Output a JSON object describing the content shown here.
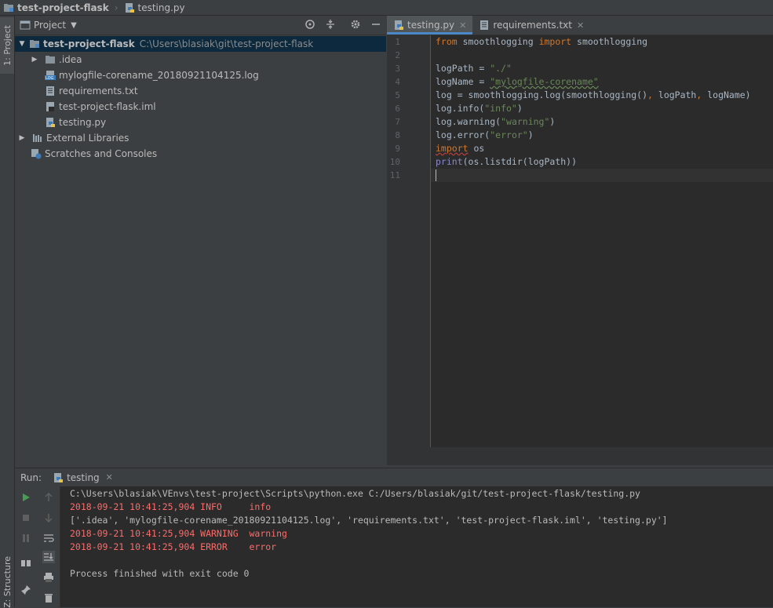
{
  "navbar": {
    "project": "test-project-flask",
    "file": "testing.py"
  },
  "left_stripe": {
    "project_tab": "1: Project",
    "structure_tab": "Z: Structure"
  },
  "project_panel": {
    "title": "Project",
    "root": {
      "label": "test-project-flask",
      "path": "C:\\Users\\blasiak\\git\\test-project-flask"
    },
    "items": [
      {
        "label": ".idea",
        "icon": "folder-icon"
      },
      {
        "label": "mylogfile-corename_20180921104125.log",
        "icon": "log-file-icon"
      },
      {
        "label": "requirements.txt",
        "icon": "text-file-icon"
      },
      {
        "label": "test-project-flask.iml",
        "icon": "iml-file-icon"
      },
      {
        "label": "testing.py",
        "icon": "python-file-icon"
      }
    ],
    "external_libraries": "External Libraries",
    "scratches": "Scratches and Consoles"
  },
  "editor": {
    "tabs": [
      {
        "label": "testing.py",
        "active": true
      },
      {
        "label": "requirements.txt",
        "active": false
      }
    ],
    "line_numbers": [
      "1",
      "2",
      "3",
      "4",
      "5",
      "6",
      "7",
      "8",
      "9",
      "10",
      "11"
    ],
    "code": {
      "l1_kw_from": "from",
      "l1_mod": " smoothlogging ",
      "l1_kw_import": "import",
      "l1_name": " smoothlogging",
      "l3_a": "logPath = ",
      "l3_str": "\"./\"",
      "l4_a": "logName = ",
      "l4_str": "\"mylogfile-corename\"",
      "l5_a": "log = smoothlogging.log(smoothlogging()",
      "l5_comma1": ",",
      "l5_b": " logPath",
      "l5_comma2": ",",
      "l5_c": " logName)",
      "l6_a": "log.info(",
      "l6_str": "\"info\"",
      "l6_b": ")",
      "l7_a": "log.warning(",
      "l7_str": "\"warning\"",
      "l7_b": ")",
      "l8_a": "log.error(",
      "l8_str": "\"error\"",
      "l8_b": ")",
      "l9_kw": "import",
      "l9_b": " os",
      "l10_fn": "print",
      "l10_b": "(os.listdir(logPath))"
    }
  },
  "run": {
    "label": "Run:",
    "tab": "testing",
    "console": [
      {
        "text": "C:\\Users\\blasiak\\VEnvs\\test-project\\Scripts\\python.exe C:/Users/blasiak/git/test-project-flask/testing.py",
        "error": false
      },
      {
        "text": "2018-09-21 10:41:25,904 INFO     info",
        "error": true
      },
      {
        "text": "['.idea', 'mylogfile-corename_20180921104125.log', 'requirements.txt', 'test-project-flask.iml', 'testing.py']",
        "error": false
      },
      {
        "text": "2018-09-21 10:41:25,904 WARNING  warning",
        "error": true
      },
      {
        "text": "2018-09-21 10:41:25,904 ERROR    error",
        "error": true
      },
      {
        "text": "",
        "error": false
      },
      {
        "text": "Process finished with exit code 0",
        "error": false
      }
    ]
  },
  "colors": {
    "accent": "#4a88c7",
    "error_text": "#ff6b68",
    "keyword": "#cc7832",
    "string": "#6a8759",
    "run_green": "#499c54"
  }
}
